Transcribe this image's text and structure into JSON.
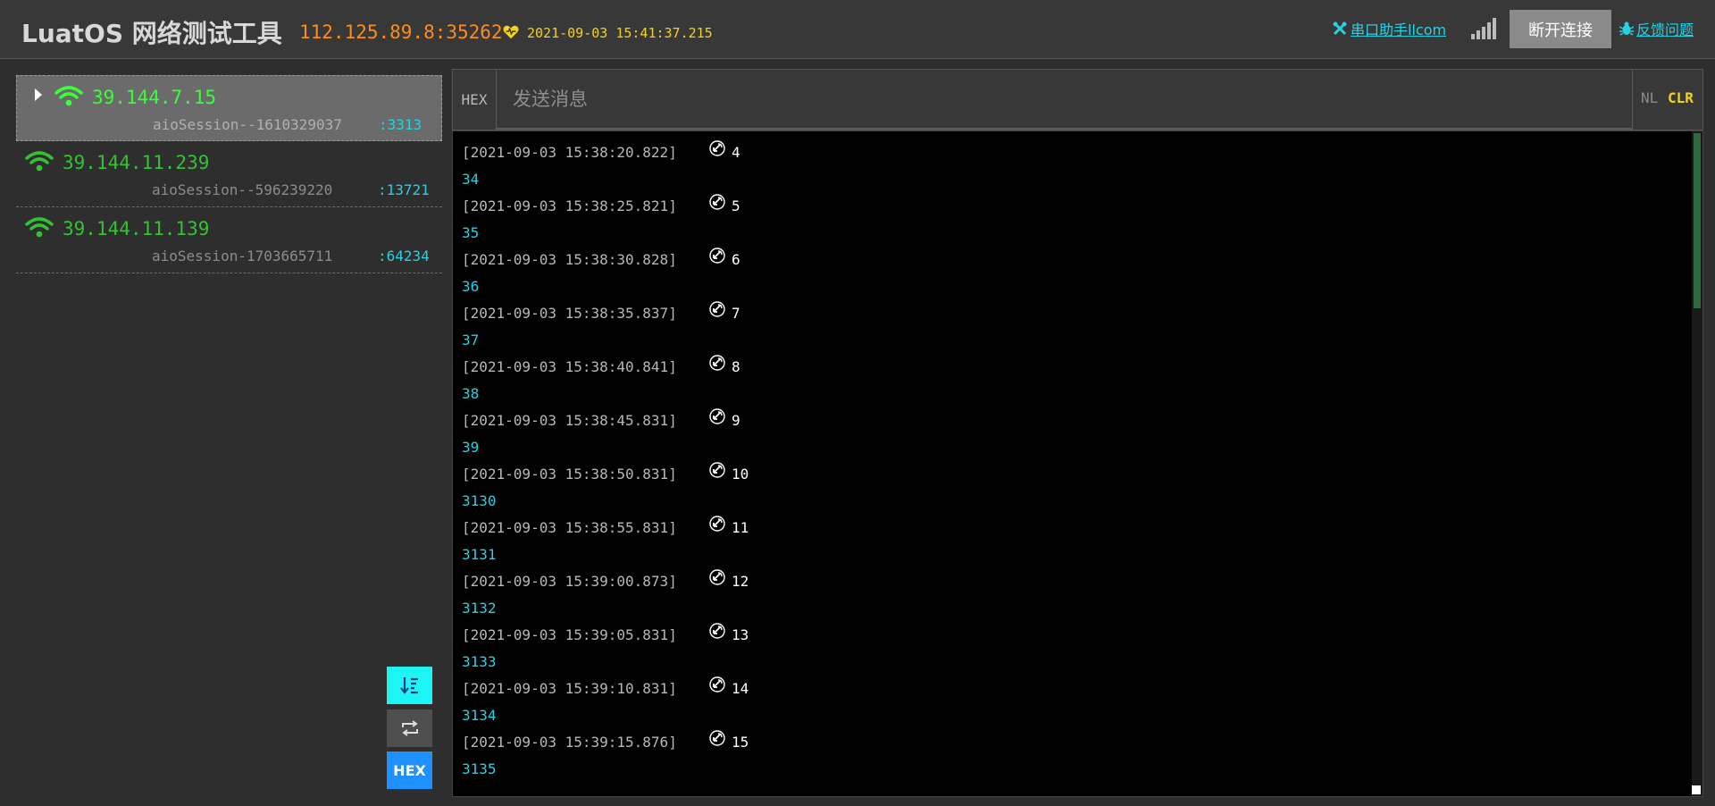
{
  "header": {
    "title": "LuatOS 网络测试工具",
    "server_address": "112.125.89.8:35262",
    "server_time": "2021-09-03 15:41:37.215",
    "serial_link": "串口助手llcom",
    "disconnect_label": "断开连接",
    "feedback_label": "反馈问题"
  },
  "sessions": [
    {
      "ip": "39.144.7.15",
      "session_id": "aioSession--1610329037",
      "port": ":3313",
      "active": true
    },
    {
      "ip": "39.144.11.239",
      "session_id": "aioSession--596239220",
      "port": ":13721",
      "active": false
    },
    {
      "ip": "39.144.11.139",
      "session_id": "aioSession-1703665711",
      "port": ":64234",
      "active": false
    }
  ],
  "side_buttons": {
    "hex_label": "HEX"
  },
  "send_bar": {
    "hex_label": "HEX",
    "placeholder": "发送消息",
    "nl_label": "NL",
    "clr_label": "CLR"
  },
  "log": [
    {
      "timestamp": "[2021-09-03 15:38:20.822]",
      "value": "4",
      "hex": "34"
    },
    {
      "timestamp": "[2021-09-03 15:38:25.821]",
      "value": "5",
      "hex": "35"
    },
    {
      "timestamp": "[2021-09-03 15:38:30.828]",
      "value": "6",
      "hex": "36"
    },
    {
      "timestamp": "[2021-09-03 15:38:35.837]",
      "value": "7",
      "hex": "37"
    },
    {
      "timestamp": "[2021-09-03 15:38:40.841]",
      "value": "8",
      "hex": "38"
    },
    {
      "timestamp": "[2021-09-03 15:38:45.831]",
      "value": "9",
      "hex": "39"
    },
    {
      "timestamp": "[2021-09-03 15:38:50.831]",
      "value": "10",
      "hex": "3130"
    },
    {
      "timestamp": "[2021-09-03 15:38:55.831]",
      "value": "11",
      "hex": "3131"
    },
    {
      "timestamp": "[2021-09-03 15:39:00.873]",
      "value": "12",
      "hex": "3132"
    },
    {
      "timestamp": "[2021-09-03 15:39:05.831]",
      "value": "13",
      "hex": "3133"
    },
    {
      "timestamp": "[2021-09-03 15:39:10.831]",
      "value": "14",
      "hex": "3134"
    },
    {
      "timestamp": "[2021-09-03 15:39:15.876]",
      "value": "15",
      "hex": "3135"
    }
  ],
  "colors": {
    "accent_cyan": "#22d3e6",
    "address_orange": "#ff8c1a",
    "time_yellow": "#f2d21c",
    "online_green": "#34c234",
    "hex_blue": "#1e90ff"
  },
  "icons": [
    "tools-icon",
    "heart-icon",
    "signal-icon",
    "bug-icon",
    "wifi-icon",
    "caret-right-icon",
    "scroll-bottom-icon",
    "loop-icon",
    "receive-icon"
  ]
}
